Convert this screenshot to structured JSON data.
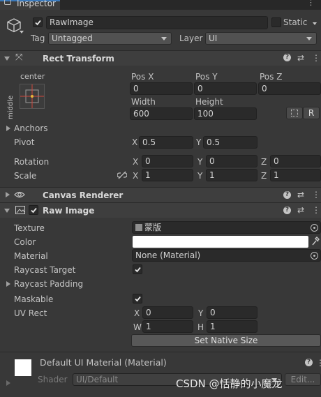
{
  "tab": {
    "title": "Inspector"
  },
  "object": {
    "name": "RawImage",
    "static_label": "Static",
    "tag_label": "Tag",
    "tag_value": "Untagged",
    "layer_label": "Layer",
    "layer_value": "UI"
  },
  "rect_transform": {
    "title": "Rect Transform",
    "anchor_h": "center",
    "anchor_v": "middle",
    "pos_x_label": "Pos X",
    "pos_x": "0",
    "pos_y_label": "Pos Y",
    "pos_y": "0",
    "pos_z_label": "Pos Z",
    "pos_z": "0",
    "width_label": "Width",
    "width": "600",
    "height_label": "Height",
    "height": "100",
    "r_button": "R",
    "anchors_label": "Anchors",
    "pivot_label": "Pivot",
    "pivot_x": "0.5",
    "pivot_y": "0.5",
    "rotation_label": "Rotation",
    "rotation_x": "0",
    "rotation_y": "0",
    "rotation_z": "0",
    "scale_label": "Scale",
    "scale_x": "1",
    "scale_y": "1",
    "scale_z": "1",
    "axis_x": "X",
    "axis_y": "Y",
    "axis_z": "Z"
  },
  "canvas_renderer": {
    "title": "Canvas Renderer"
  },
  "raw_image": {
    "title": "Raw Image",
    "texture_label": "Texture",
    "texture_value": "蒙版",
    "color_label": "Color",
    "color_value": "#ffffff",
    "material_label": "Material",
    "material_value": "None (Material)",
    "raycast_target_label": "Raycast Target",
    "raycast_padding_label": "Raycast Padding",
    "maskable_label": "Maskable",
    "uv_rect_label": "UV Rect",
    "uv_x": "0",
    "uv_y": "0",
    "uv_w": "1",
    "uv_h": "1",
    "axis_x": "X",
    "axis_y": "Y",
    "axis_w": "W",
    "axis_h": "H",
    "set_native_size": "Set Native Size"
  },
  "default_material": {
    "title": "Default UI Material (Material)",
    "shader_label": "Shader",
    "shader_value": "UI/Default",
    "edit_label": "Edit..."
  },
  "watermark": "CSDN @恬静的小魔龙"
}
